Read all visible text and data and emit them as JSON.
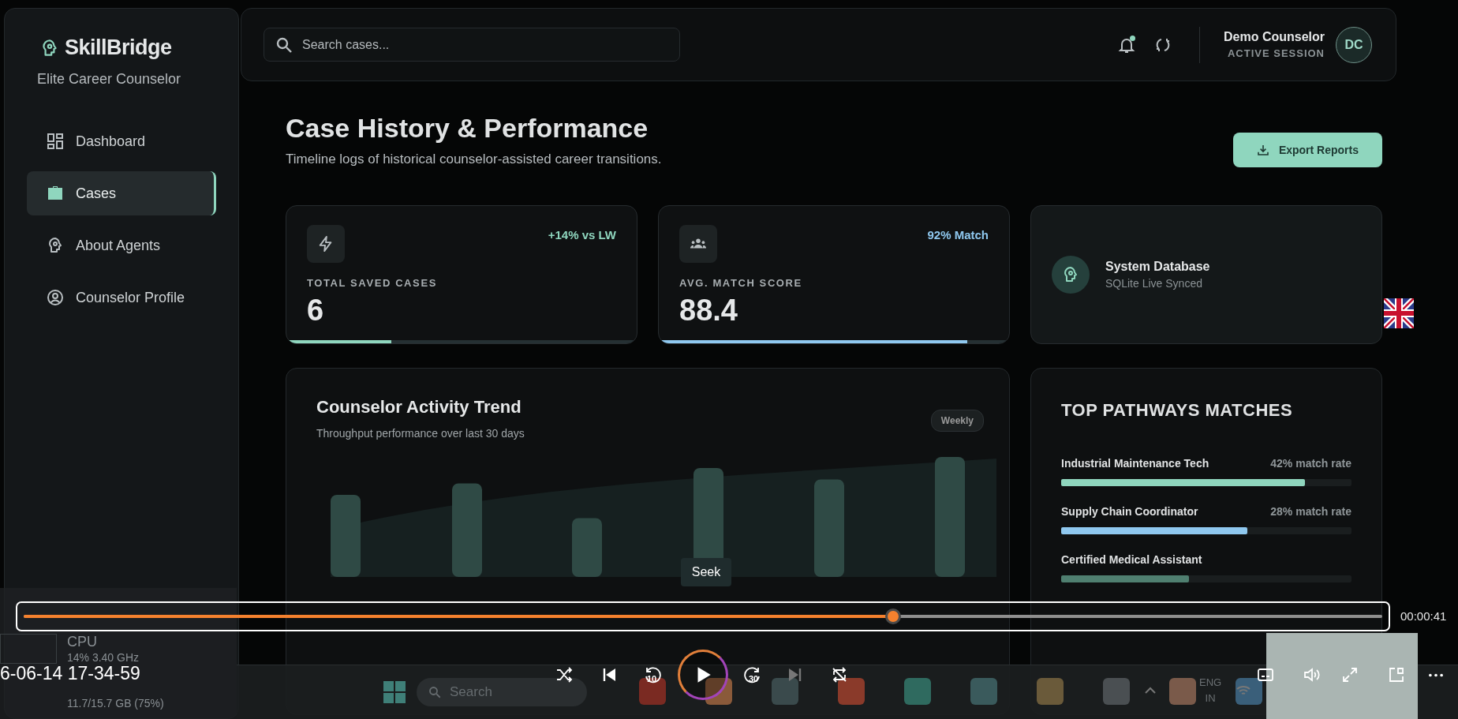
{
  "sidebar": {
    "brand": "SkillBridge",
    "tagline": "Elite Career Counselor",
    "items": [
      {
        "label": "Dashboard",
        "selected": false
      },
      {
        "label": "Cases",
        "selected": true
      },
      {
        "label": "About Agents",
        "selected": false
      },
      {
        "label": "Counselor Profile",
        "selected": false
      }
    ]
  },
  "topbar": {
    "search": {
      "placeholder": "Search cases..."
    },
    "unread": true,
    "user": {
      "name": "Demo Counselor",
      "status": "ACTIVE SESSION",
      "initials": "DC"
    }
  },
  "page": {
    "title": "Case History & Performance",
    "subtitle": "Timeline logs of historical counselor-assisted career transitions.",
    "export_button": "Export Reports"
  },
  "stats": [
    {
      "kind": "metric",
      "label": "TOTAL SAVED CASES",
      "value": "6",
      "delta": "+14% vs LW",
      "level": 0.3,
      "color": "#8fd6be"
    },
    {
      "kind": "metric",
      "label": "AVG. MATCH SCORE",
      "value": "88.4",
      "delta": "92% Match",
      "level": 0.88,
      "color": "#8fc8ef"
    },
    {
      "kind": "status",
      "title": "System Database",
      "subtitle": "SQLite Live Synced"
    }
  ],
  "activity": {
    "title": "Counselor Activity Trend",
    "subtitle": "Throughput performance over last 30 days",
    "period": "Weekly"
  },
  "pathways": {
    "title": "TOP PATHWAYS MATCHES",
    "items": [
      {
        "name": "Industrial Maintenance Tech",
        "rate": "42% match rate",
        "level": 0.84,
        "color": "#8fd6be"
      },
      {
        "name": "Supply Chain Coordinator",
        "rate": "28% match rate",
        "level": 0.64,
        "color": "#8fc8ef"
      },
      {
        "name": "Certified Medical Assistant",
        "level": 0.44,
        "color": "#4f7f70"
      }
    ]
  },
  "desktop_widget": {
    "cpu_label": "CPU",
    "cpu_reading": "14% 3.40 GHz",
    "memory_reading": "11.7/15.7 GB (75%)"
  },
  "player": {
    "file_name": "6-06-14 17-34-59",
    "level": 0.64,
    "elapsed": "00:00:41",
    "tooltip": "Seek",
    "rewind": "10",
    "forward": "30",
    "next_disabled": true
  },
  "taskbar": {
    "search": {
      "placeholder": "Search"
    },
    "language": "ENG",
    "region": "IN"
  }
}
